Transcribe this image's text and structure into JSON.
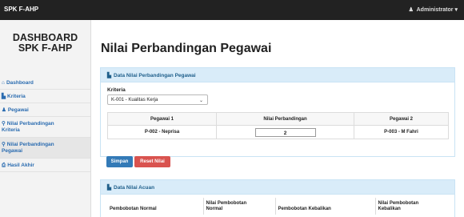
{
  "topbar": {
    "brand": "SPK F-AHP",
    "user": "Administrator",
    "user_icon": "user-icon",
    "caret": "▾"
  },
  "sidebar": {
    "title_line1": "DASHBOARD",
    "title_line2": "SPK F-AHP",
    "items": [
      {
        "label": "Dashboard",
        "icon": "home-icon"
      },
      {
        "label": "Kriteria",
        "icon": "file-icon"
      },
      {
        "label": "Pegawai",
        "icon": "user-icon"
      },
      {
        "label_line1": "Nilai Perbandingan",
        "label_line2": "Kriteria",
        "icon": "search-icon"
      },
      {
        "label_line1": "Nilai Perbandingan",
        "label_line2": "Pegawai",
        "icon": "search-icon"
      },
      {
        "label": "Hasil Akhir",
        "icon": "print-icon"
      }
    ]
  },
  "main": {
    "title": "Nilai Perbandingan Pegawai",
    "data_card": {
      "header": "Data Nilai Perbandingan Pegawai",
      "kriteria_label": "Kriteria",
      "kriteria_selected": "K-001 - Kualitas Kerja",
      "table": {
        "headers": [
          "Pegawai 1",
          "Nilai Perbandingan",
          "Pegawai 2"
        ],
        "row": {
          "pegawai1": "P-002 - Neprisa",
          "nilai": "2",
          "pegawai2": "P-003 - M Fahri"
        }
      },
      "save_label": "Simpan",
      "reset_label": "Reset Nilai"
    },
    "acuan_card": {
      "header": "Data Nilai Acuan",
      "headers": {
        "col1": "Pembobotan Normal",
        "col2_line1": "Nilai Pembobotan",
        "col2_line2": "Normal",
        "col3": "Pembobotan Kebalikan",
        "col4_line1": "Nilai Pembobotan",
        "col4_line2": "Kebalikan"
      }
    }
  }
}
